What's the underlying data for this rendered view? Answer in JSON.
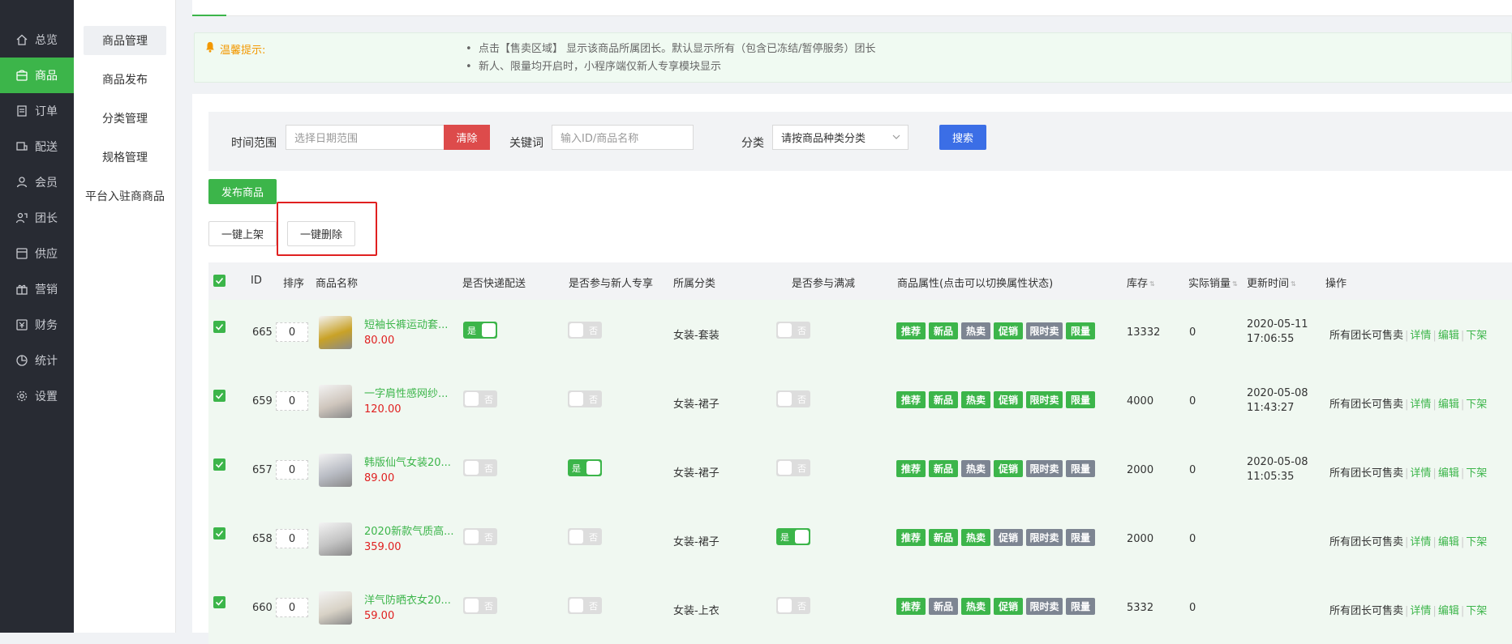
{
  "nav": [
    {
      "label": "总览",
      "icon": "home-icon"
    },
    {
      "label": "商品",
      "icon": "shop-icon",
      "active": true
    },
    {
      "label": "订单",
      "icon": "order-icon"
    },
    {
      "label": "配送",
      "icon": "delivery-icon"
    },
    {
      "label": "会员",
      "icon": "member-icon"
    },
    {
      "label": "团长",
      "icon": "leader-icon"
    },
    {
      "label": "供应",
      "icon": "supply-icon"
    },
    {
      "label": "营销",
      "icon": "gift-icon"
    },
    {
      "label": "财务",
      "icon": "finance-icon"
    },
    {
      "label": "统计",
      "icon": "chart-icon"
    },
    {
      "label": "设置",
      "icon": "gear-icon"
    }
  ],
  "submenu": [
    "商品管理",
    "商品发布",
    "分类管理",
    "规格管理",
    "平台入驻商商品"
  ],
  "notice": {
    "title": "温馨提示:",
    "lines": [
      "点击【售卖区域】 显示该商品所属团长。默认显示所有（包含已冻结/暂停服务）团长",
      "新人、限量均开启时，小程序端仅新人专享模块显示"
    ]
  },
  "filter": {
    "time_label": "时间范围",
    "time_placeholder": "选择日期范围",
    "clear": "清除",
    "keyword_label": "关键词",
    "keyword_placeholder": "输入ID/商品名称",
    "category_label": "分类",
    "category_value": "请按商品种类分类",
    "search": "搜索"
  },
  "actions": {
    "publish": "发布商品",
    "batch_on": "一键上架",
    "batch_delete": "一键删除"
  },
  "table": {
    "headers": [
      "ID",
      "排序",
      "商品名称",
      "是否快递配送",
      "是否参与新人专享",
      "所属分类",
      "是否参与满减",
      "商品属性(点击可以切换属性状态)",
      "库存",
      "实际销量",
      "更新时间",
      "操作"
    ],
    "yes": "是",
    "no": "否",
    "tags": [
      "推荐",
      "新品",
      "热卖",
      "促销",
      "限时卖",
      "限量"
    ],
    "ops": {
      "sale": "所有团长可售卖",
      "detail": "详情",
      "edit": "编辑",
      "off": "下架"
    },
    "rows": [
      {
        "id": "665",
        "sort": "0",
        "name": "短袖长裤运动套...",
        "price": "80.00",
        "express": true,
        "newcomer": false,
        "category": "女装-套装",
        "fullcut": false,
        "tag_on": [
          true,
          true,
          false,
          true,
          false,
          true
        ],
        "stock": "13332",
        "sales": "0",
        "date": "2020-05-11",
        "time": "17:06:55",
        "thumb": "#c9a227"
      },
      {
        "id": "659",
        "sort": "0",
        "name": "一字肩性感网纱...",
        "price": "120.00",
        "express": false,
        "newcomer": false,
        "category": "女装-裙子",
        "fullcut": false,
        "tag_on": [
          true,
          true,
          true,
          true,
          true,
          true
        ],
        "stock": "4000",
        "sales": "0",
        "date": "2020-05-08",
        "time": "11:43:27",
        "thumb": "#cfc6bd"
      },
      {
        "id": "657",
        "sort": "0",
        "name": "韩版仙气女装20...",
        "price": "89.00",
        "express": false,
        "newcomer": true,
        "category": "女装-裙子",
        "fullcut": false,
        "tag_on": [
          true,
          true,
          false,
          true,
          false,
          false
        ],
        "stock": "2000",
        "sales": "0",
        "date": "2020-05-08",
        "time": "11:05:35",
        "thumb": "#b9bcc4"
      },
      {
        "id": "658",
        "sort": "0",
        "name": "2020新款气质高...",
        "price": "359.00",
        "express": false,
        "newcomer": false,
        "category": "女装-裙子",
        "fullcut": true,
        "tag_on": [
          true,
          true,
          true,
          false,
          false,
          false
        ],
        "stock": "2000",
        "sales": "0",
        "date": "",
        "time": "",
        "thumb": "#c4c4c4"
      },
      {
        "id": "660",
        "sort": "0",
        "name": "洋气防晒衣女20...",
        "price": "59.00",
        "express": false,
        "newcomer": false,
        "category": "女装-上衣",
        "fullcut": false,
        "tag_on": [
          true,
          false,
          true,
          true,
          false,
          false
        ],
        "stock": "5332",
        "sales": "0",
        "date": "",
        "time": "",
        "thumb": "#d8d2c6"
      }
    ]
  }
}
